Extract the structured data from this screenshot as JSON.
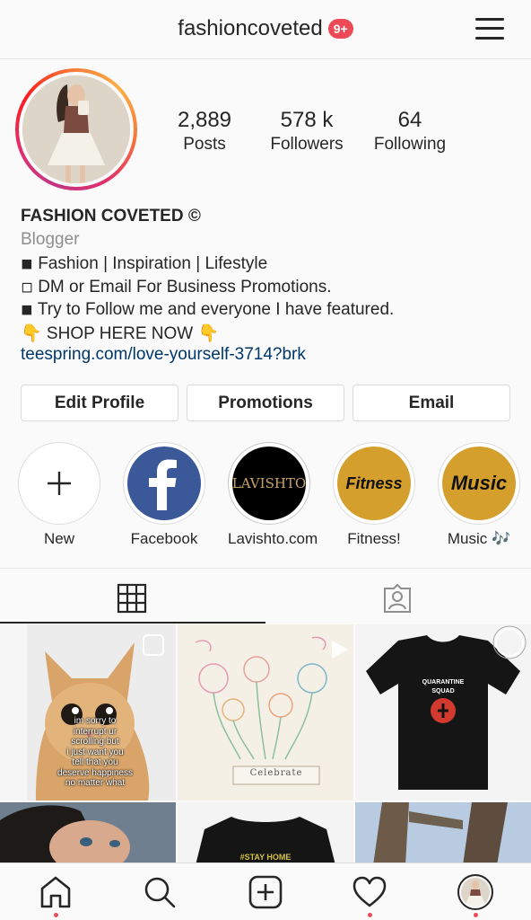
{
  "header": {
    "username": "fashioncoveted",
    "notification_badge": "9+"
  },
  "profile": {
    "stats": [
      {
        "value": "2,889",
        "label": "Posts"
      },
      {
        "value": "578 k",
        "label": "Followers"
      },
      {
        "value": "64",
        "label": "Following"
      }
    ],
    "display_name": "FASHION COVETED ©",
    "category": "Blogger",
    "bio_lines": [
      "◾ Fashion | Inspiration | Lifestyle",
      "◽ DM or Email For Business Promotions.",
      "◾ Try to Follow me and everyone I have featured.",
      "👇 SHOP HERE NOW 👇"
    ],
    "link": "teespring.com/love-yourself-3714?brk"
  },
  "actions": {
    "edit_profile": "Edit Profile",
    "promotions": "Promotions",
    "email": "Email"
  },
  "highlights": [
    {
      "label": "New",
      "icon": "plus-icon"
    },
    {
      "label": "Facebook",
      "icon": "facebook-logo-icon"
    },
    {
      "label": "Lavishto.com",
      "cover_text": "LAVISHTO"
    },
    {
      "label": "Fitness!",
      "cover_text": "Fitness"
    },
    {
      "label": "Music 🎶",
      "cover_text": "Music"
    }
  ],
  "tabs": [
    {
      "name": "grid",
      "icon": "grid-icon",
      "active": true
    },
    {
      "name": "tagged",
      "icon": "tagged-user-icon",
      "active": false
    }
  ],
  "posts": {
    "kitten_caption": [
      "im sorry to",
      "interrupt ur",
      "scrolling but",
      "i just want you",
      "tell that you",
      "deserve happiness",
      "no matter what"
    ],
    "flower_caption": "Celebrate",
    "shirt_text_line1": "QUARANTINE",
    "shirt_text_line2": "SQUAD",
    "shirt2_text": "#STAY HOME"
  },
  "bottom_nav": [
    {
      "name": "home",
      "icon": "home-icon"
    },
    {
      "name": "search",
      "icon": "search-icon"
    },
    {
      "name": "new-post",
      "icon": "add-post-icon"
    },
    {
      "name": "activity",
      "icon": "heart-icon"
    },
    {
      "name": "profile",
      "icon": "profile-avatar"
    }
  ],
  "colors": {
    "badge": "#ed4956",
    "link": "#00376b",
    "secondary_text": "#8e8e8e",
    "facebook": "#3b5998",
    "highlight_gold": "#d59f2e"
  }
}
